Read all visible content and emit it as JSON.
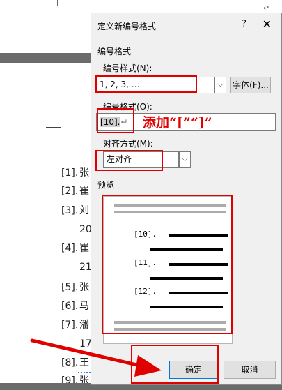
{
  "background_document": {
    "top_mark": "↵",
    "refs": [
      {
        "num": "[1].",
        "text": "张"
      },
      {
        "num": "[2].",
        "text": "崔"
      },
      {
        "num": "[3].",
        "text": "刘"
      },
      {
        "num": "",
        "text": "20"
      },
      {
        "num": "[4].",
        "text": "崔"
      },
      {
        "num": "",
        "text": "21"
      },
      {
        "num": "[5].",
        "text": "张"
      },
      {
        "num": "[6].",
        "text": "马"
      },
      {
        "num": "[7].",
        "text": "潘"
      },
      {
        "num": "",
        "text": "17"
      },
      {
        "num": "[8].",
        "text": "王"
      },
      {
        "num": "[9].",
        "text": "张"
      }
    ]
  },
  "dialog": {
    "title": "定义新编号格式",
    "help": "?",
    "close": "✕",
    "section_label": "编号格式",
    "style_label": "编号样式(N):",
    "style_value": "1, 2, 3, …",
    "style_dropdown_glyph": "⌵",
    "font_button": "字体(F)...",
    "format_label": "编号格式(O):",
    "format_value": "[10].",
    "format_mark": "↵",
    "align_label": "对齐方式(M):",
    "align_value": "左对齐",
    "align_dropdown_glyph": "⌵",
    "preview_label": "预览",
    "preview_items": [
      "[10].",
      "[11].",
      "[12]."
    ],
    "ok_button": "确定",
    "cancel_button": "取消"
  },
  "annotation": {
    "text": "添加“[”“]”",
    "color": "#e00000"
  },
  "colors": {
    "dialog_bg": "#f0f0f0",
    "highlight_red": "#e00000",
    "ok_border": "#0078d7"
  }
}
